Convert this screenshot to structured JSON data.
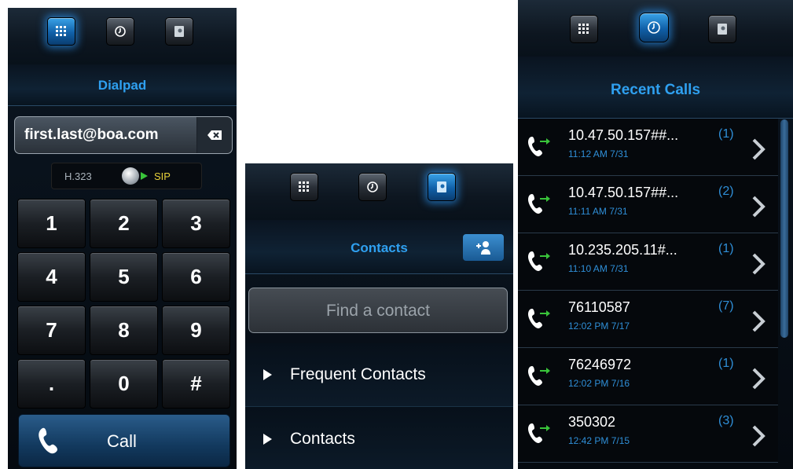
{
  "dialpad": {
    "title": "Dialpad",
    "address": "first.last@boa.com",
    "protocol": {
      "left": "H.323",
      "right": "SIP",
      "selected": "SIP"
    },
    "keys": [
      "1",
      "2",
      "3",
      "4",
      "5",
      "6",
      "7",
      "8",
      "9",
      ".",
      "0",
      "#"
    ],
    "call_label": "Call"
  },
  "contacts": {
    "title": "Contacts",
    "search_placeholder": "Find a contact",
    "groups": [
      "Frequent Contacts",
      "Contacts"
    ]
  },
  "recents": {
    "title": "Recent Calls",
    "calls": [
      {
        "number": "10.47.50.157##...",
        "time": "11:12 AM 7/31",
        "count": "(1)"
      },
      {
        "number": "10.47.50.157##...",
        "time": "11:11 AM 7/31",
        "count": "(2)"
      },
      {
        "number": "10.235.205.11#...",
        "time": "11:10 AM 7/31",
        "count": "(1)"
      },
      {
        "number": "76110587",
        "time": "12:02 PM 7/17",
        "count": "(7)"
      },
      {
        "number": "76246972",
        "time": "12:02 PM 7/16",
        "count": "(1)"
      },
      {
        "number": "350302",
        "time": "12:42 PM 7/15",
        "count": "(3)"
      }
    ]
  },
  "icons": {
    "tabs": [
      "dialpad-grid-icon",
      "clock-icon",
      "address-book-icon"
    ],
    "call": "phone-handset-icon",
    "outgoing": "outgoing-call-icon",
    "add_contact": "add-contact-icon"
  },
  "colors": {
    "accent": "#2fa0f0",
    "sip": "#e8d23a",
    "outgoing_arrow": "#39c43a"
  }
}
